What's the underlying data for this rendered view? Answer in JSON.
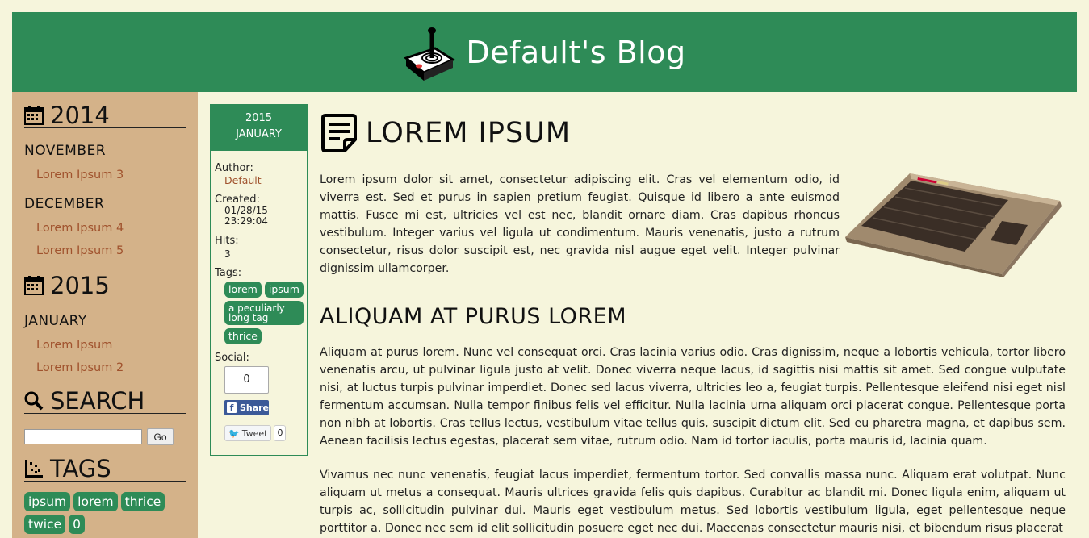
{
  "header": {
    "title": "Default's Blog",
    "logo_icon": "joystick-icon"
  },
  "sidebar": {
    "archive": [
      {
        "year": "2014",
        "months": [
          {
            "name": "NOVEMBER",
            "posts": [
              "Lorem Ipsum 3"
            ]
          },
          {
            "name": "DECEMBER",
            "posts": [
              "Lorem Ipsum 4",
              "Lorem Ipsum 5"
            ]
          }
        ]
      },
      {
        "year": "2015",
        "months": [
          {
            "name": "JANUARY",
            "posts": [
              "Lorem Ipsum",
              "Lorem Ipsum 2"
            ]
          }
        ]
      }
    ],
    "search": {
      "heading": "SEARCH",
      "placeholder": "",
      "button": "Go"
    },
    "tags": {
      "heading": "TAGS",
      "items": [
        "ipsum",
        "lorem",
        "thrice",
        "twice",
        "0"
      ]
    }
  },
  "info": {
    "date_year": "2015",
    "date_month": "JANUARY",
    "author_label": "Author:",
    "author": "Default",
    "created_label": "Created:",
    "created_date": "01/28/15",
    "created_time": "23:29:04",
    "hits_label": "Hits:",
    "hits": "3",
    "tags_label": "Tags:",
    "tags": [
      "lorem",
      "ipsum",
      "a peculiarly long tag",
      "thrice"
    ],
    "social_label": "Social:",
    "fb_count": "0",
    "fb_share": "Share",
    "tweet": "Tweet",
    "tweet_count": "0"
  },
  "article": {
    "title": "LOREM IPSUM",
    "intro": "Lorem ipsum dolor sit amet, consectetur adipiscing elit. Cras vel elementum odio, id viverra est. Sed et purus in sapien pretium feugiat. Quisque id libero a ante euismod mattis. Fusce mi est, ultricies vel est nec, blandit ornare diam. Cras dapibus rhoncus vestibulum. Integer varius vel ligula ut condimentum. Mauris venenatis, justo a rutrum consectetur, risus dolor suscipit est, nec gravida nisl augue eget velit. Integer pulvinar dignissim ullamcorper.",
    "subheading": "ALIQUAM AT PURUS LOREM",
    "para1": "Aliquam at purus lorem. Nunc vel consequat orci. Cras lacinia varius odio. Cras dignissim, neque a lobortis vehicula, tortor libero venenatis arcu, ut pulvinar ligula justo at velit. Donec viverra neque lacus, id sagittis nisi mattis sit amet. Sed congue vulputate nisi, at luctus turpis pulvinar imperdiet. Donec sed lacus viverra, ultricies leo a, feugiat turpis. Pellentesque eleifend nisi eget nisl fermentum accumsan. Nulla tempor finibus felis vel efficitur. Nulla lacinia urna aliquam orci placerat congue. Pellentesque porta non nibh at lobortis. Cras tellus lectus, vestibulum vitae tellus quis, suscipit dictum elit. Sed eu pharetra magna, et dapibus sem. Aenean facilisis lectus egestas, placerat sem vitae, rutrum odio. Nam id tortor iaculis, porta mauris id, lacinia quam.",
    "para2": "Vivamus nec nunc venenatis, feugiat lacus imperdiet, fermentum tortor. Sed convallis massa nunc. Aliquam erat volutpat. Nunc aliquam ut metus a consequat. Mauris ultrices gravida felis quis dapibus. Curabitur ac blandit mi. Donec ligula enim, aliquam ut turpis ac, sollicitudin pulvinar dui. Mauris eget vestibulum metus. Sed lobortis vestibulum ligula, eget pellentesque neque porttitor a. Donec nec sem id elit sollicitudin posuere eget nec dui. Maecenas consectetur mauris nisi, et bibendum risus placerat"
  }
}
